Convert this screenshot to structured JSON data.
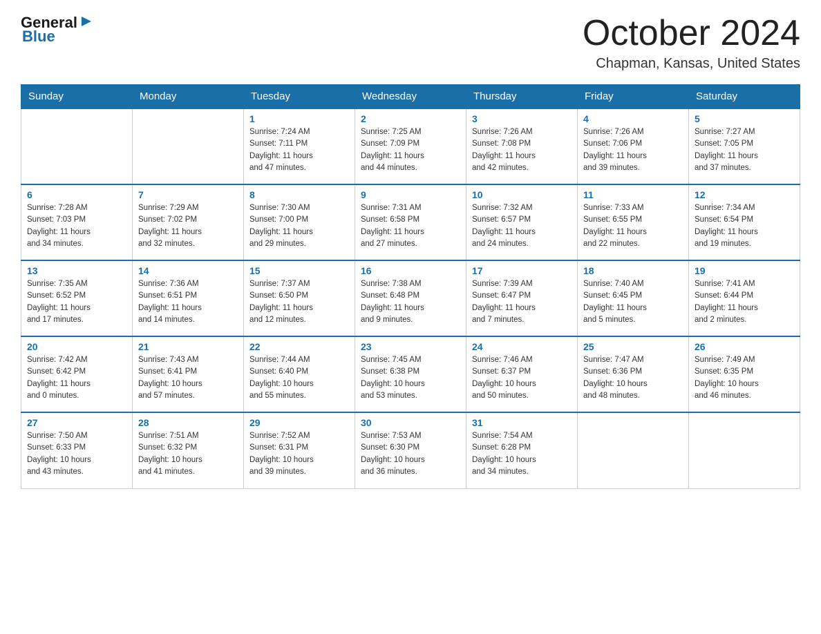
{
  "header": {
    "logo_general": "General",
    "logo_blue": "Blue",
    "month_title": "October 2024",
    "location": "Chapman, Kansas, United States"
  },
  "days_of_week": [
    "Sunday",
    "Monday",
    "Tuesday",
    "Wednesday",
    "Thursday",
    "Friday",
    "Saturday"
  ],
  "weeks": [
    [
      {
        "day": "",
        "info": ""
      },
      {
        "day": "",
        "info": ""
      },
      {
        "day": "1",
        "info": "Sunrise: 7:24 AM\nSunset: 7:11 PM\nDaylight: 11 hours\nand 47 minutes."
      },
      {
        "day": "2",
        "info": "Sunrise: 7:25 AM\nSunset: 7:09 PM\nDaylight: 11 hours\nand 44 minutes."
      },
      {
        "day": "3",
        "info": "Sunrise: 7:26 AM\nSunset: 7:08 PM\nDaylight: 11 hours\nand 42 minutes."
      },
      {
        "day": "4",
        "info": "Sunrise: 7:26 AM\nSunset: 7:06 PM\nDaylight: 11 hours\nand 39 minutes."
      },
      {
        "day": "5",
        "info": "Sunrise: 7:27 AM\nSunset: 7:05 PM\nDaylight: 11 hours\nand 37 minutes."
      }
    ],
    [
      {
        "day": "6",
        "info": "Sunrise: 7:28 AM\nSunset: 7:03 PM\nDaylight: 11 hours\nand 34 minutes."
      },
      {
        "day": "7",
        "info": "Sunrise: 7:29 AM\nSunset: 7:02 PM\nDaylight: 11 hours\nand 32 minutes."
      },
      {
        "day": "8",
        "info": "Sunrise: 7:30 AM\nSunset: 7:00 PM\nDaylight: 11 hours\nand 29 minutes."
      },
      {
        "day": "9",
        "info": "Sunrise: 7:31 AM\nSunset: 6:58 PM\nDaylight: 11 hours\nand 27 minutes."
      },
      {
        "day": "10",
        "info": "Sunrise: 7:32 AM\nSunset: 6:57 PM\nDaylight: 11 hours\nand 24 minutes."
      },
      {
        "day": "11",
        "info": "Sunrise: 7:33 AM\nSunset: 6:55 PM\nDaylight: 11 hours\nand 22 minutes."
      },
      {
        "day": "12",
        "info": "Sunrise: 7:34 AM\nSunset: 6:54 PM\nDaylight: 11 hours\nand 19 minutes."
      }
    ],
    [
      {
        "day": "13",
        "info": "Sunrise: 7:35 AM\nSunset: 6:52 PM\nDaylight: 11 hours\nand 17 minutes."
      },
      {
        "day": "14",
        "info": "Sunrise: 7:36 AM\nSunset: 6:51 PM\nDaylight: 11 hours\nand 14 minutes."
      },
      {
        "day": "15",
        "info": "Sunrise: 7:37 AM\nSunset: 6:50 PM\nDaylight: 11 hours\nand 12 minutes."
      },
      {
        "day": "16",
        "info": "Sunrise: 7:38 AM\nSunset: 6:48 PM\nDaylight: 11 hours\nand 9 minutes."
      },
      {
        "day": "17",
        "info": "Sunrise: 7:39 AM\nSunset: 6:47 PM\nDaylight: 11 hours\nand 7 minutes."
      },
      {
        "day": "18",
        "info": "Sunrise: 7:40 AM\nSunset: 6:45 PM\nDaylight: 11 hours\nand 5 minutes."
      },
      {
        "day": "19",
        "info": "Sunrise: 7:41 AM\nSunset: 6:44 PM\nDaylight: 11 hours\nand 2 minutes."
      }
    ],
    [
      {
        "day": "20",
        "info": "Sunrise: 7:42 AM\nSunset: 6:42 PM\nDaylight: 11 hours\nand 0 minutes."
      },
      {
        "day": "21",
        "info": "Sunrise: 7:43 AM\nSunset: 6:41 PM\nDaylight: 10 hours\nand 57 minutes."
      },
      {
        "day": "22",
        "info": "Sunrise: 7:44 AM\nSunset: 6:40 PM\nDaylight: 10 hours\nand 55 minutes."
      },
      {
        "day": "23",
        "info": "Sunrise: 7:45 AM\nSunset: 6:38 PM\nDaylight: 10 hours\nand 53 minutes."
      },
      {
        "day": "24",
        "info": "Sunrise: 7:46 AM\nSunset: 6:37 PM\nDaylight: 10 hours\nand 50 minutes."
      },
      {
        "day": "25",
        "info": "Sunrise: 7:47 AM\nSunset: 6:36 PM\nDaylight: 10 hours\nand 48 minutes."
      },
      {
        "day": "26",
        "info": "Sunrise: 7:49 AM\nSunset: 6:35 PM\nDaylight: 10 hours\nand 46 minutes."
      }
    ],
    [
      {
        "day": "27",
        "info": "Sunrise: 7:50 AM\nSunset: 6:33 PM\nDaylight: 10 hours\nand 43 minutes."
      },
      {
        "day": "28",
        "info": "Sunrise: 7:51 AM\nSunset: 6:32 PM\nDaylight: 10 hours\nand 41 minutes."
      },
      {
        "day": "29",
        "info": "Sunrise: 7:52 AM\nSunset: 6:31 PM\nDaylight: 10 hours\nand 39 minutes."
      },
      {
        "day": "30",
        "info": "Sunrise: 7:53 AM\nSunset: 6:30 PM\nDaylight: 10 hours\nand 36 minutes."
      },
      {
        "day": "31",
        "info": "Sunrise: 7:54 AM\nSunset: 6:28 PM\nDaylight: 10 hours\nand 34 minutes."
      },
      {
        "day": "",
        "info": ""
      },
      {
        "day": "",
        "info": ""
      }
    ]
  ]
}
